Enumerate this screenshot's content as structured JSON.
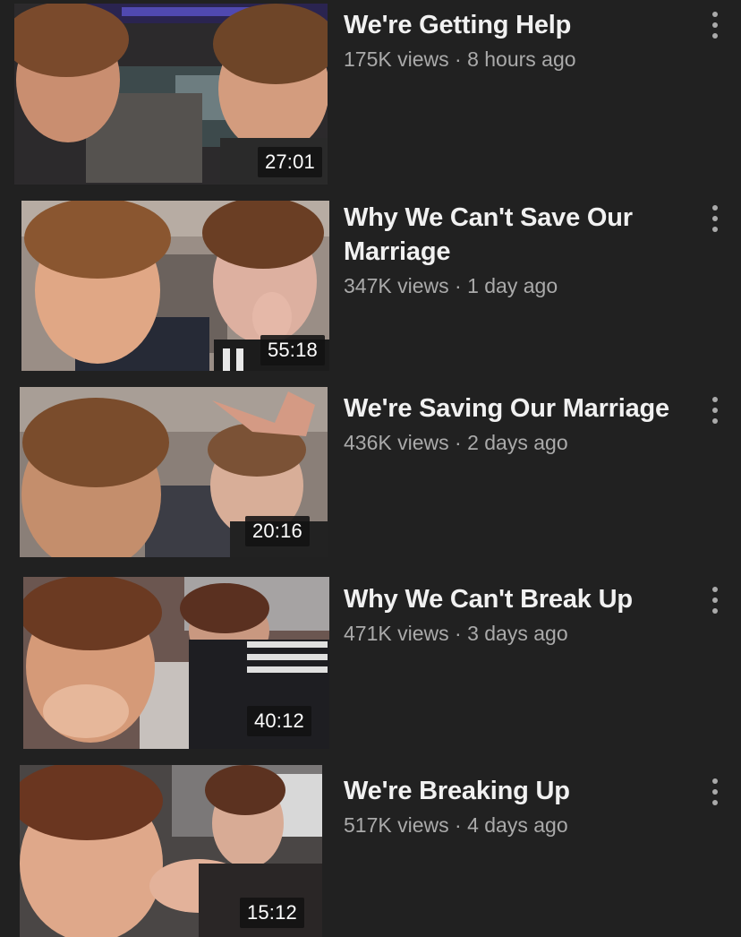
{
  "theme": {
    "background": "#212121",
    "title_color": "#f1f1f1",
    "meta_color": "#aaaaaa",
    "duration_bg": "#121212"
  },
  "videos": [
    {
      "title": "We're Getting Help",
      "views": "175K views",
      "separator": "·",
      "age": "8 hours ago",
      "duration": "27:01",
      "menu_icon": "more-vertical-icon"
    },
    {
      "title": "Why We Can't Save Our Marriage",
      "views": "347K views",
      "separator": "·",
      "age": "1 day ago",
      "duration": "55:18",
      "menu_icon": "more-vertical-icon"
    },
    {
      "title": "We're Saving Our Marriage",
      "views": "436K views",
      "separator": "·",
      "age": "2 days ago",
      "duration": "20:16",
      "menu_icon": "more-vertical-icon"
    },
    {
      "title": "Why We Can't Break Up",
      "views": "471K views",
      "separator": "·",
      "age": "3 days ago",
      "duration": "40:12",
      "menu_icon": "more-vertical-icon"
    },
    {
      "title": "We're Breaking Up",
      "views": "517K views",
      "separator": "·",
      "age": "4 days ago",
      "duration": "15:12",
      "menu_icon": "more-vertical-icon"
    }
  ]
}
